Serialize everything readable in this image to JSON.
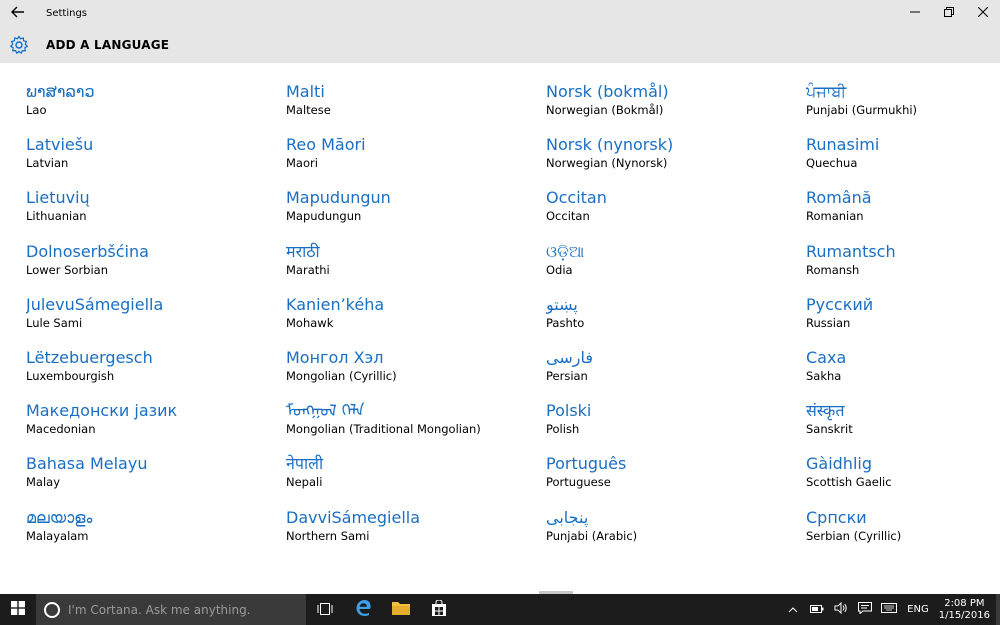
{
  "window": {
    "app_title": "Settings",
    "back_icon": "back-arrow-icon",
    "controls": [
      "minimize-icon",
      "restore-icon",
      "close-icon"
    ]
  },
  "header": {
    "icon": "gear-icon",
    "title": "ADD A LANGUAGE"
  },
  "languages": {
    "col1": [
      {
        "native": "ພາສາລາວ",
        "english": "Lao"
      },
      {
        "native": "Latviešu",
        "english": "Latvian"
      },
      {
        "native": "Lietuvių",
        "english": "Lithuanian"
      },
      {
        "native": "Dolnoserbšćina",
        "english": "Lower Sorbian"
      },
      {
        "native": "JulevuSámegiella",
        "english": "Lule Sami"
      },
      {
        "native": "Lëtzebuergesch",
        "english": "Luxembourgish"
      },
      {
        "native": "Македонски јазик",
        "english": "Macedonian"
      },
      {
        "native": "Bahasa Melayu",
        "english": "Malay"
      },
      {
        "native": "മലയാളം",
        "english": "Malayalam"
      }
    ],
    "col2": [
      {
        "native": "Malti",
        "english": "Maltese"
      },
      {
        "native": "Reo Māori",
        "english": "Maori"
      },
      {
        "native": "Mapudungun",
        "english": "Mapudungun"
      },
      {
        "native": "मराठी",
        "english": "Marathi"
      },
      {
        "native": "Kanien’kéha",
        "english": "Mohawk"
      },
      {
        "native": "Монгол Хэл",
        "english": "Mongolian (Cyrillic)"
      },
      {
        "native": "ᠮᠣᠩᠭᠣᠯ ᠬᠡᠯᠡ",
        "english": "Mongolian (Traditional Mongolian)"
      },
      {
        "native": "नेपाली",
        "english": "Nepali"
      },
      {
        "native": "DavviSámegiella",
        "english": "Northern Sami"
      }
    ],
    "col3": [
      {
        "native": "Norsk (bokmål)",
        "english": "Norwegian (Bokmål)"
      },
      {
        "native": "Norsk (nynorsk)",
        "english": "Norwegian (Nynorsk)"
      },
      {
        "native": "Occitan",
        "english": "Occitan"
      },
      {
        "native": "ଓଡ଼ିଆ",
        "english": "Odia"
      },
      {
        "native": "پښتو",
        "english": "Pashto"
      },
      {
        "native": "فارسی",
        "english": "Persian"
      },
      {
        "native": "Polski",
        "english": "Polish"
      },
      {
        "native": "Português",
        "english": "Portuguese"
      },
      {
        "native": "پنجابی",
        "english": "Punjabi (Arabic)"
      }
    ],
    "col4": [
      {
        "native": "ਪੰਜਾਬੀ",
        "english": "Punjabi (Gurmukhi)"
      },
      {
        "native": "Runasimi",
        "english": "Quechua"
      },
      {
        "native": "Română",
        "english": "Romanian"
      },
      {
        "native": "Rumantsch",
        "english": "Romansh"
      },
      {
        "native": "Русский",
        "english": "Russian"
      },
      {
        "native": "Саха",
        "english": "Sakha"
      },
      {
        "native": "संस्कृत",
        "english": "Sanskrit"
      },
      {
        "native": "Gàidhlig",
        "english": "Scottish Gaelic"
      },
      {
        "native": "Српски",
        "english": "Serbian (Cyrillic)"
      }
    ]
  },
  "taskbar": {
    "search_placeholder": "I'm Cortana. Ask me anything.",
    "pinned": [
      "task-view-icon",
      "edge-icon",
      "file-explorer-icon",
      "store-icon"
    ],
    "tray_icons": [
      "chevron-up-icon",
      "battery-icon",
      "volume-icon",
      "action-center-icon",
      "keyboard-icon"
    ],
    "input_language": "ENG",
    "time": "2:08 PM",
    "date": "1/15/2016"
  },
  "colors": {
    "accent": "#1a6fc4",
    "chrome": "#e6e6e6",
    "taskbar": "#1c1c1c"
  }
}
